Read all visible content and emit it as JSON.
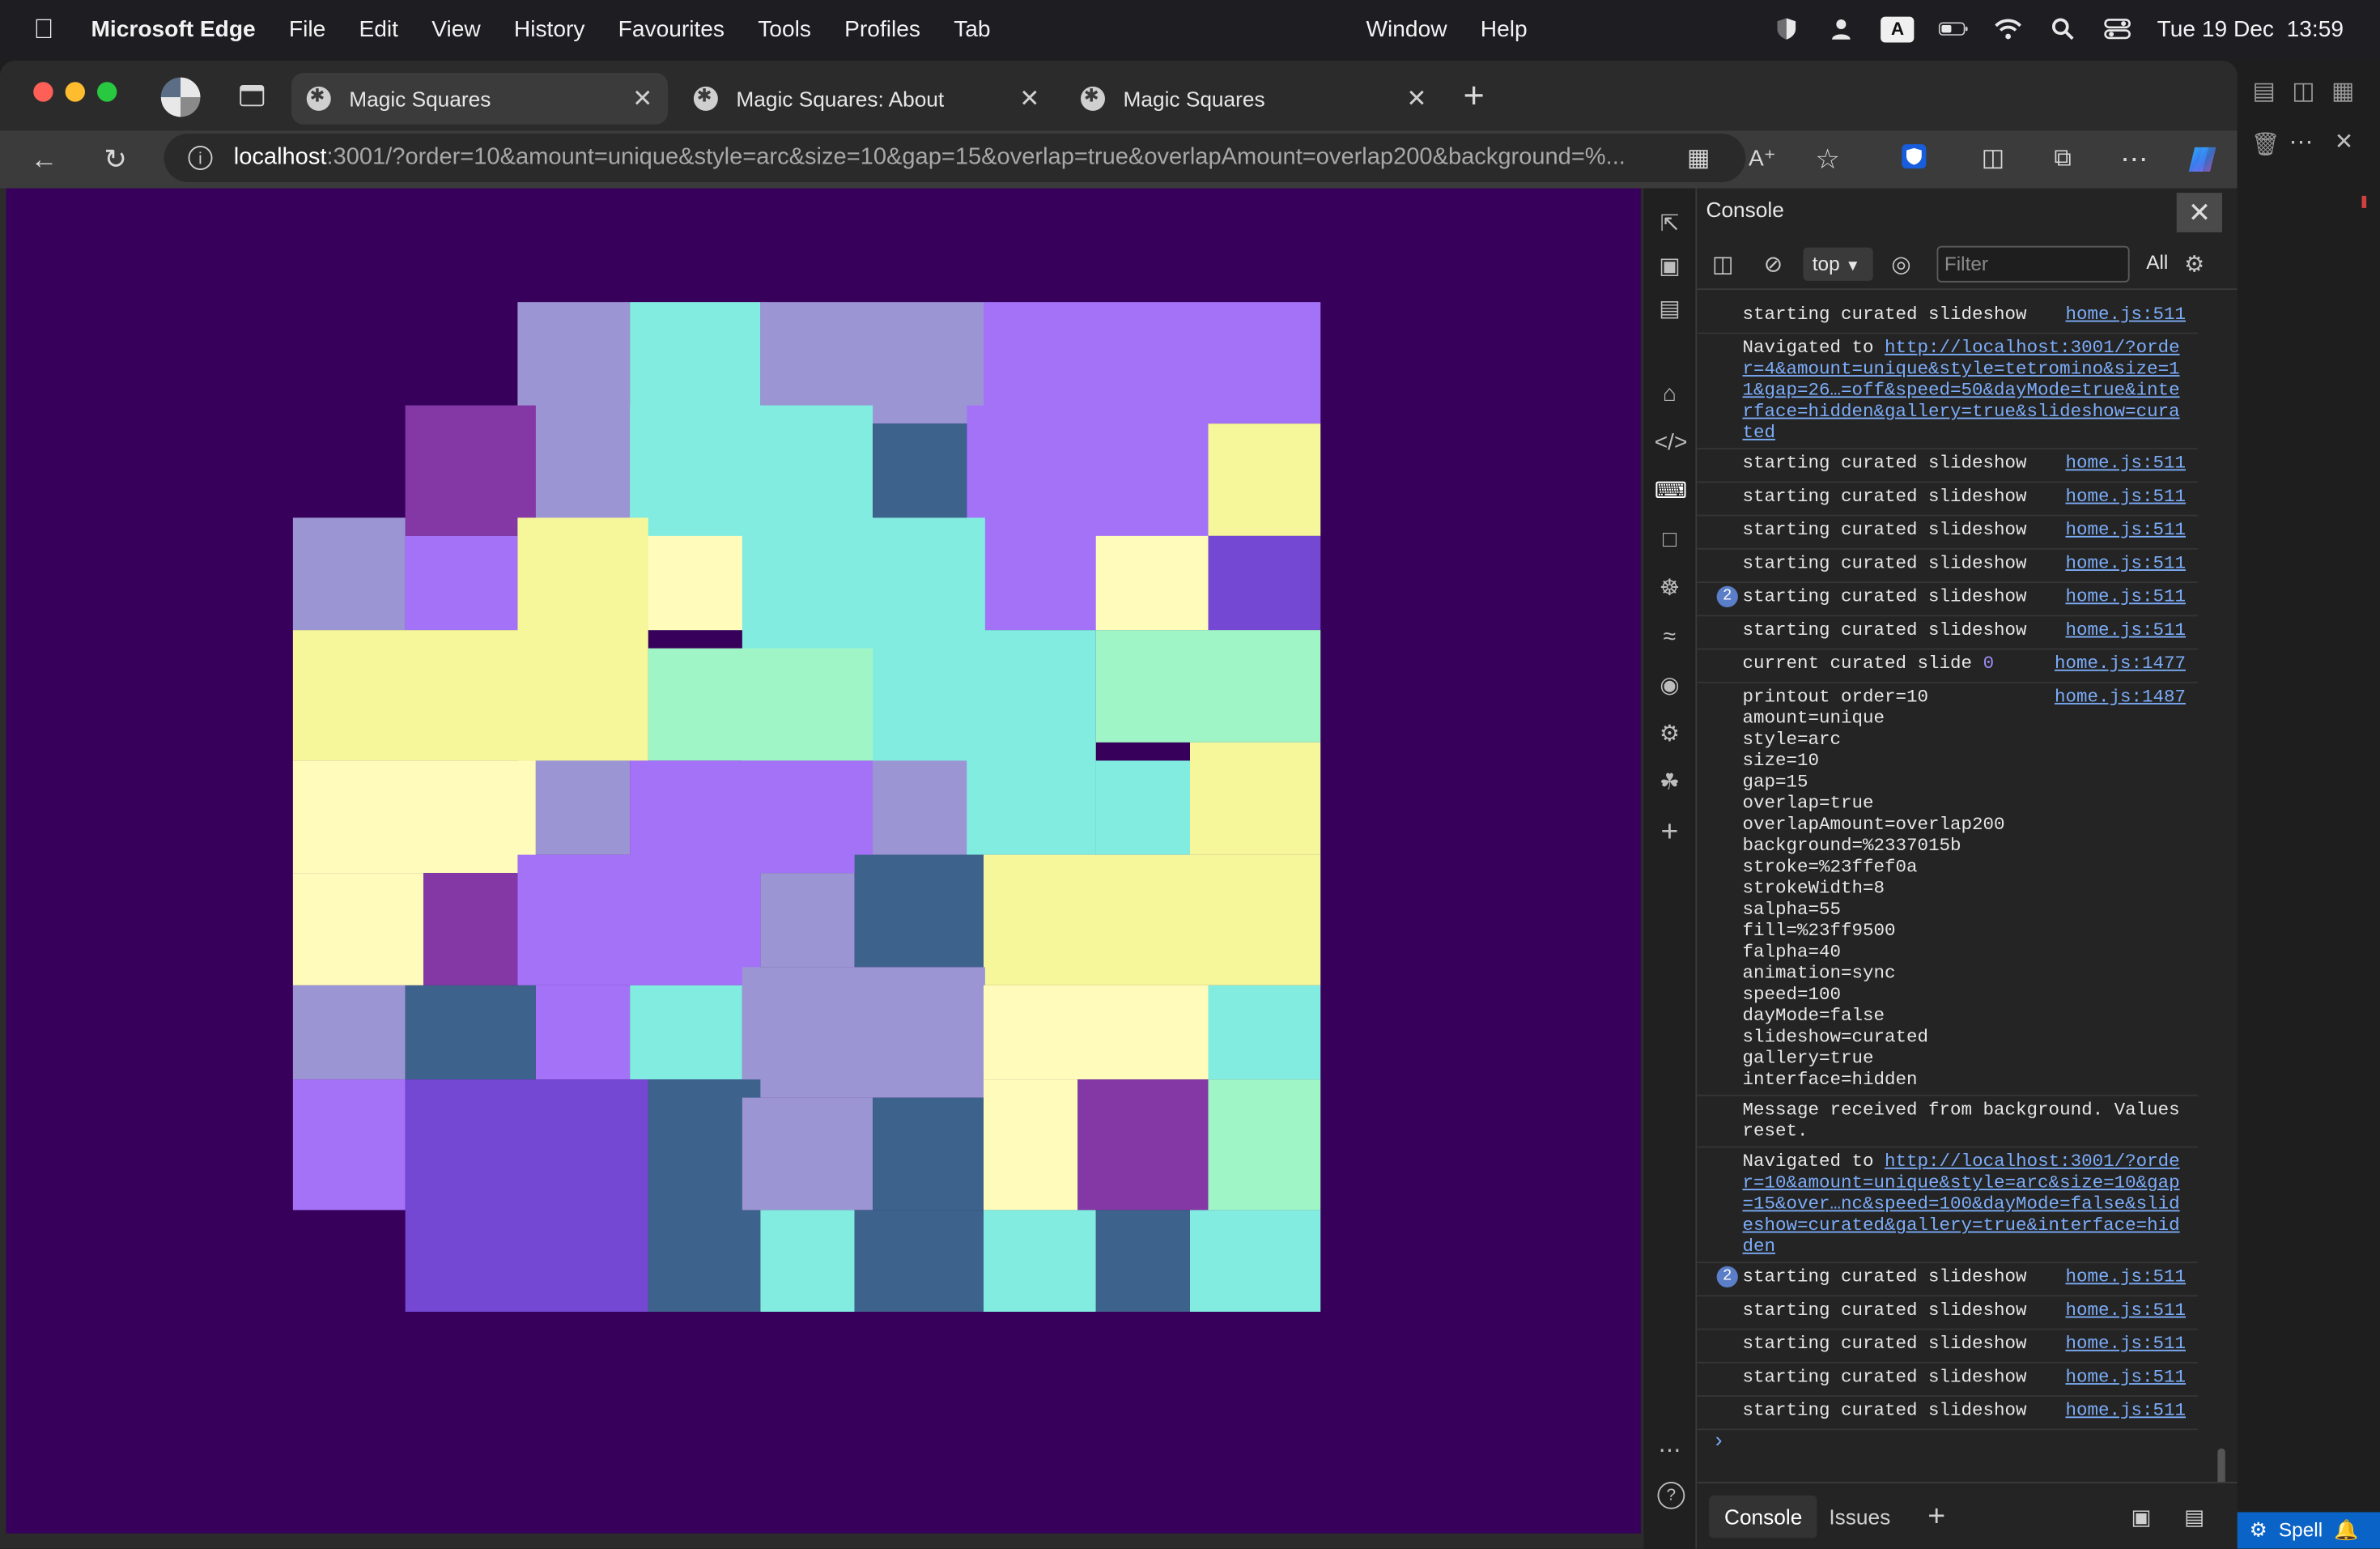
{
  "menubar": {
    "app": "Microsoft Edge",
    "menus": [
      "File",
      "Edit",
      "View",
      "History",
      "Favourites",
      "Tools",
      "Profiles",
      "Tab"
    ],
    "menus_right": [
      "Window",
      "Help"
    ],
    "clock": "Tue 19 Dec  13:59",
    "input_source": "A"
  },
  "tabs": [
    {
      "title": "Magic Squares",
      "active": true
    },
    {
      "title": "Magic Squares: About",
      "active": false
    },
    {
      "title": "Magic Squares",
      "active": false
    }
  ],
  "address": {
    "host": "localhost",
    "rest": ":3001/?order=10&amount=unique&style=arc&size=10&gap=15&overlap=true&overlapAmount=overlap200&background=%..."
  },
  "page": {
    "background": "#37015b"
  },
  "colors": {
    "lavender": "#9b95d4",
    "violet": "#a472f7",
    "aqua": "#82ece0",
    "plum": "#8338a5",
    "steel": "#3d628c",
    "lemon": "#f5f79a",
    "cream": "#fffcbb",
    "mint": "#a0f5c6",
    "indigo": "#7548d3"
  },
  "devtools": {
    "panel_title": "Console",
    "context": "top",
    "filter_placeholder": "Filter",
    "levels": "All",
    "messages": [
      {
        "kind": "log",
        "text": "starting curated slideshow",
        "src": "home.js:511"
      },
      {
        "kind": "nav",
        "prefix": "Navigated to ",
        "url": "http://localhost:3001/?order=4&amount=unique&style=tetromino&size=11&gap=26…=off&speed=50&dayMode=true&interface=hidden&gallery=true&slideshow=curated"
      },
      {
        "kind": "log",
        "text": "starting curated slideshow",
        "src": "home.js:511"
      },
      {
        "kind": "log",
        "text": "starting curated slideshow",
        "src": "home.js:511"
      },
      {
        "kind": "log",
        "text": "starting curated slideshow",
        "src": "home.js:511"
      },
      {
        "kind": "log",
        "text": "starting curated slideshow",
        "src": "home.js:511"
      },
      {
        "kind": "log",
        "text": "starting curated slideshow",
        "src": "home.js:511",
        "count": "2"
      },
      {
        "kind": "log",
        "text": "starting curated slideshow",
        "src": "home.js:511"
      },
      {
        "kind": "log",
        "text": "current curated slide ",
        "num": "0",
        "src": "home.js:1477"
      },
      {
        "kind": "log",
        "text": "printout order=10\namount=unique\nstyle=arc\nsize=10\ngap=15\noverlap=true\noverlapAmount=overlap200\nbackground=%2337015b\nstroke=%23ffef0a\nstrokeWidth=8\nsalpha=55\nfill=%23ff9500\nfalpha=40\nanimation=sync\nspeed=100\ndayMode=false\nslideshow=curated\ngallery=true\ninterface=hidden",
        "src": "home.js:1487"
      },
      {
        "kind": "log",
        "text": "Message received from background. Values\nreset."
      },
      {
        "kind": "nav",
        "prefix": "Navigated to ",
        "url": "http://localhost:3001/?order=10&amount=unique&style=arc&size=10&gap=15&over…nc&speed=100&dayMode=false&slideshow=curated&gallery=true&interface=hidden"
      },
      {
        "kind": "log",
        "text": "starting curated slideshow",
        "src": "home.js:511",
        "count": "2"
      },
      {
        "kind": "log",
        "text": "starting curated slideshow",
        "src": "home.js:511"
      },
      {
        "kind": "log",
        "text": "starting curated slideshow",
        "src": "home.js:511"
      },
      {
        "kind": "log",
        "text": "starting curated slideshow",
        "src": "home.js:511"
      },
      {
        "kind": "log",
        "text": "starting curated slideshow",
        "src": "home.js:511"
      }
    ],
    "drawer_tabs": [
      "Console",
      "Issues"
    ]
  },
  "status": {
    "spell": "Spell"
  }
}
